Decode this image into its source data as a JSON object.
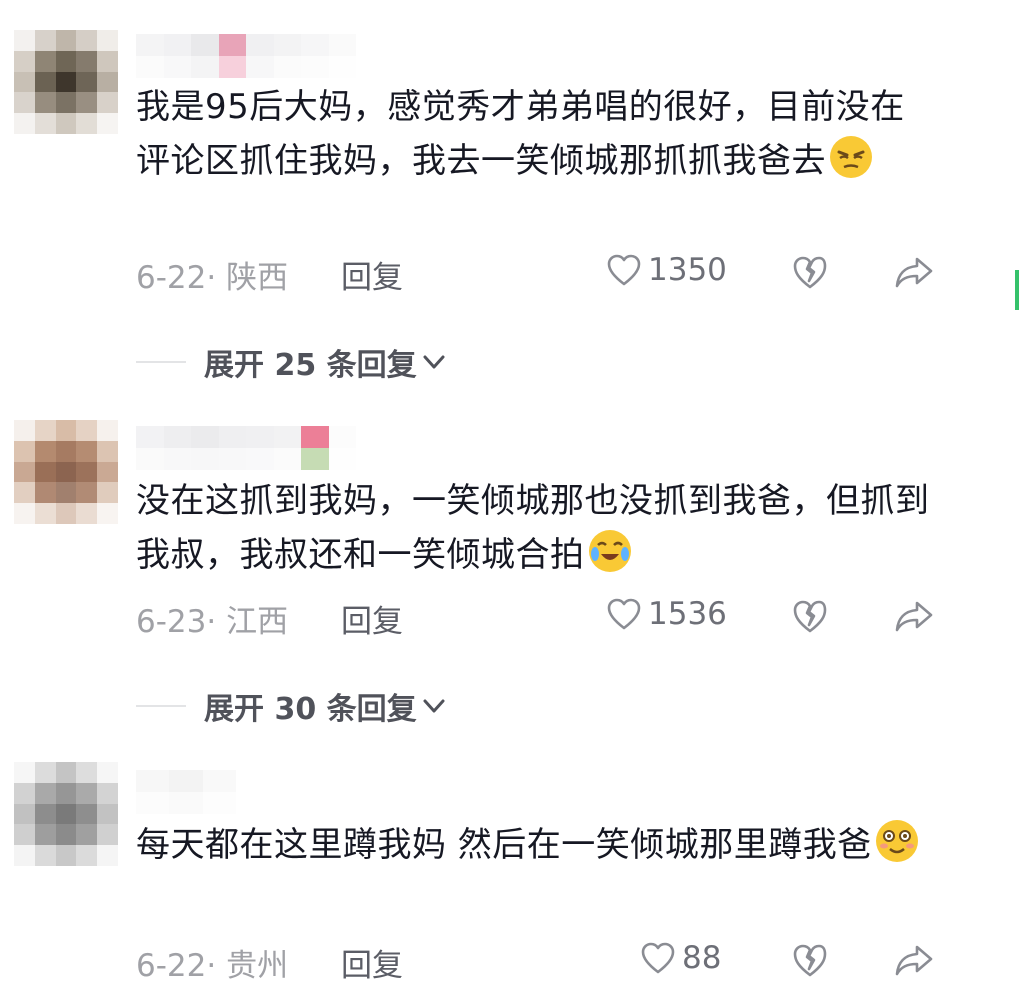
{
  "comments": [
    {
      "text": "我是95后大妈，感觉秀才弟弟唱的很好，目前没在评论区抓住我妈，我去一笑倾城那抓抓我爸去",
      "emoji": "smirk-emoji",
      "date_location": "6-22· 陕西",
      "reply_label": "回复",
      "likes": "1350",
      "expand_label": "展开 25 条回复"
    },
    {
      "text": "没在这抓到我妈，一笑倾城那也没抓到我爸，但抓到我叔，我叔还和一笑倾城合拍",
      "emoji": "crying-laughing-emoji",
      "date_location": "6-23· 江西",
      "reply_label": "回复",
      "likes": "1536",
      "expand_label": "展开 30 条回复"
    },
    {
      "text": "每天都在这里蹲我妈 然后在一笑倾城那里蹲我爸",
      "emoji": "blushing-smile-emoji",
      "date_location": "6-22· 贵州",
      "reply_label": "回复",
      "likes": "88"
    }
  ],
  "colors": {
    "text": "#161823",
    "meta": "#9a9ba1",
    "accent_scroll": "#35c26b",
    "emoji_yellow": "#f9c935"
  }
}
